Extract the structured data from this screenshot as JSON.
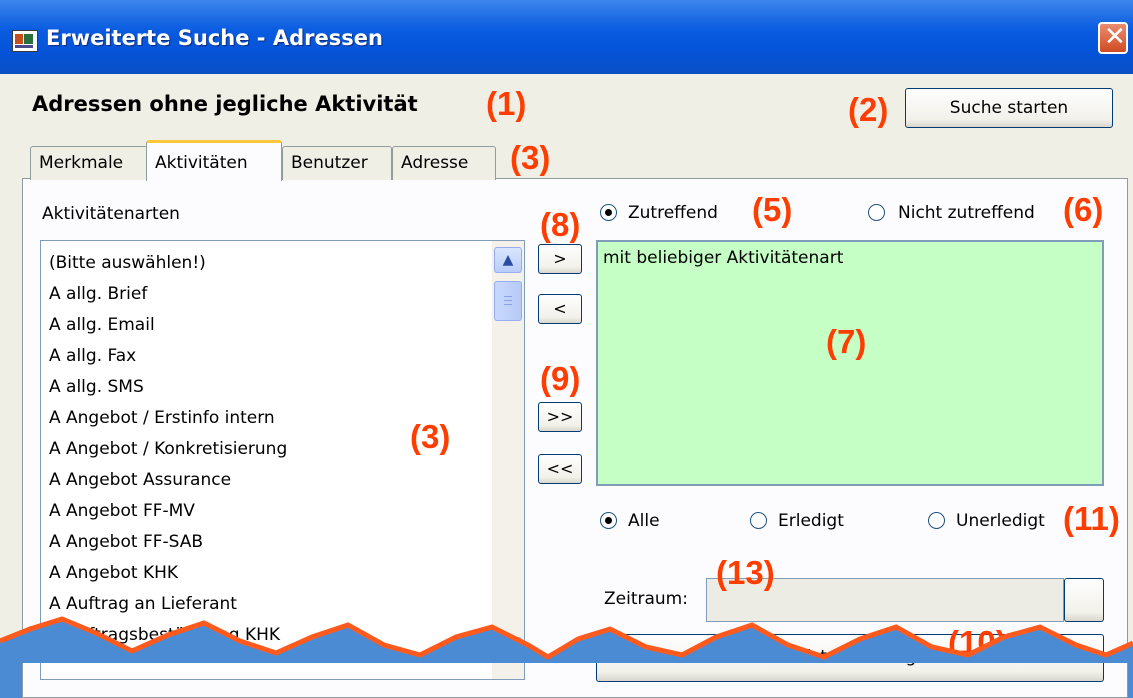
{
  "window": {
    "title": "Erweiterte Suche - Adressen"
  },
  "heading": "Adressen ohne jegliche Aktivität",
  "start_button": "Suche starten",
  "tabs": [
    "Merkmale",
    "Aktivitäten",
    "Benutzer",
    "Adresse"
  ],
  "activity_types_label": "Aktivitätenarten",
  "activity_list": [
    "(Bitte auswählen!)",
    "A allg. Brief",
    "A allg. Email",
    "A allg. Fax",
    "A allg. SMS",
    "A Angebot / Erstinfo intern",
    "A Angebot / Konkretisierung",
    "A Angebot Assurance",
    "A Angebot FF-MV",
    "A Angebot FF-SAB",
    "A Angebot KHK",
    "A Auftrag an Lieferant",
    "A Auftragsbestätigung KHK"
  ],
  "move_buttons": {
    "add": ">",
    "remove": "<",
    "add_all": ">>",
    "remove_all": "<<"
  },
  "match_radios": {
    "match": "Zutreffend",
    "no_match": "Nicht zutreffend",
    "selected": "match"
  },
  "selected_box_text": "mit beliebiger Aktivitätenart",
  "status_radios": {
    "all": "Alle",
    "done": "Erledigt",
    "open": "Unerledigt",
    "selected": "all"
  },
  "zeitraum_label": "Zeitraum:",
  "add_button": "Zur Liste hinzufügen",
  "annotations": {
    "a1": "(1)",
    "a2": "(2)",
    "a3_tabs": "(3)",
    "a3_list": "(3)",
    "a5": "(5)",
    "a6": "(6)",
    "a7": "(7)",
    "a8": "(8)",
    "a9": "(9)",
    "a10": "(10)",
    "a11": "(11)",
    "a13": "(13)"
  },
  "colors": {
    "annotation": "#ff3d00",
    "selection_box": "#c5ffc5",
    "titlebar": "#0553d9"
  }
}
